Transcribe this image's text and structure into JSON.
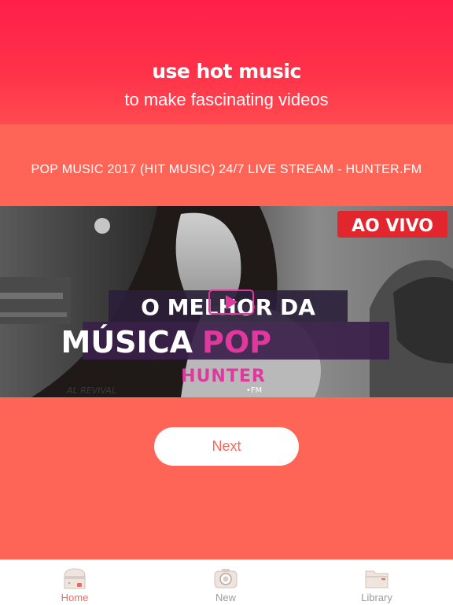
{
  "header": {
    "headline": "use hot music",
    "subline": "to make fascinating videos"
  },
  "stream": {
    "title": "POP MUSIC 2017 (HIT MUSIC) 24/7 LIVE STREAM - HUNTER.FM",
    "thumbnail": {
      "badge": "AO VIVO",
      "line1": "O MELHOR DA",
      "line2a": "MÚSICA",
      "line2b": "POP",
      "brand": "HUNTER",
      "brand_sub": "•FM",
      "sign": "AL REVIVAL"
    }
  },
  "actions": {
    "next_label": "Next"
  },
  "tabbar": {
    "tabs": [
      {
        "label": "Home",
        "icon": "home-icon",
        "active": true
      },
      {
        "label": "New",
        "icon": "camera-icon",
        "active": false
      },
      {
        "label": "Library",
        "icon": "folder-icon",
        "active": false
      }
    ]
  },
  "colors": {
    "background": "#FF6557",
    "header_gradient_top": "#FF1F4A",
    "accent": "#FF6557",
    "brand_pink": "#E0389C"
  }
}
